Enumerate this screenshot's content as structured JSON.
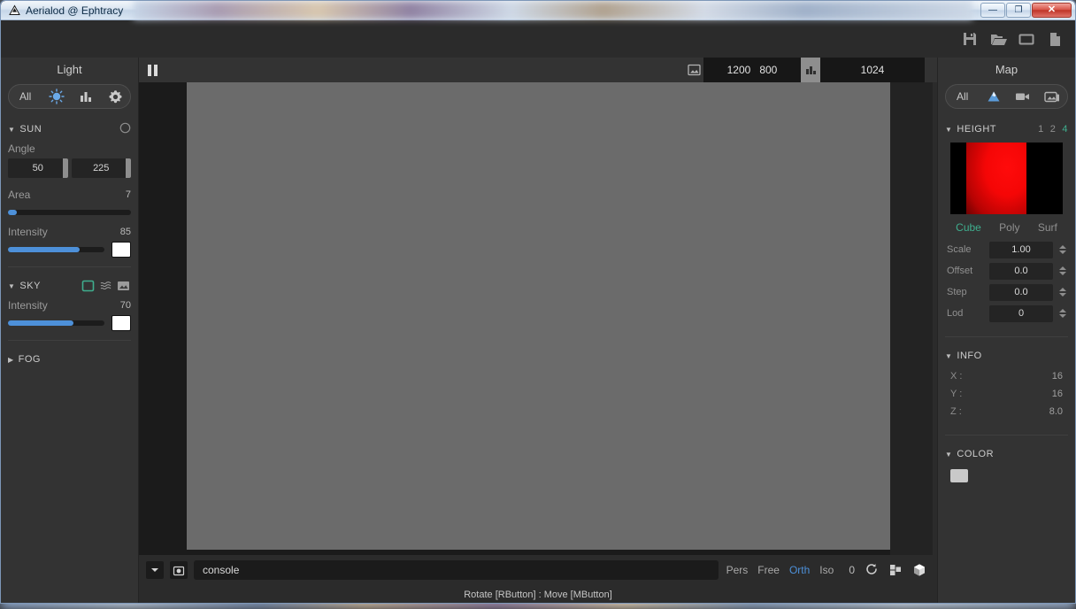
{
  "window": {
    "title": "Aerialod @ Ephtracy",
    "app_icon": "triangle-mountain-icon",
    "minimize_label": "—",
    "maximize_label": "❐",
    "close_label": "✕"
  },
  "toolbar": {
    "icons": [
      {
        "name": "save-icon",
        "label": "Save"
      },
      {
        "name": "open-folder-icon",
        "label": "Open"
      },
      {
        "name": "folder-icon",
        "label": "Folder"
      },
      {
        "name": "new-file-icon",
        "label": "New"
      }
    ]
  },
  "left_panel": {
    "title": "Light",
    "tabs": [
      {
        "name": "all",
        "label": "All",
        "active": false
      },
      {
        "name": "sun",
        "label": "sun-icon",
        "active": true
      },
      {
        "name": "histogram",
        "label": "bar-chart-icon",
        "active": false
      },
      {
        "name": "settings",
        "label": "gear-icon",
        "active": false
      }
    ],
    "sun": {
      "title": "SUN",
      "expanded": true,
      "toggle_icon": "circle-icon",
      "angle": {
        "label": "Angle",
        "value_a": "50",
        "value_b": "225"
      },
      "area": {
        "label": "Area",
        "value": "7",
        "fill_percent": 7
      },
      "intensity": {
        "label": "Intensity",
        "value": "85",
        "fill_percent": 74,
        "color": "#ffffff"
      }
    },
    "sky": {
      "title": "SKY",
      "expanded": true,
      "icons": [
        {
          "name": "solid-color-icon",
          "active": true
        },
        {
          "name": "gradient-icon",
          "active": false
        },
        {
          "name": "image-icon",
          "active": false
        }
      ],
      "intensity": {
        "label": "Intensity",
        "value": "70",
        "fill_percent": 68,
        "color": "#ffffff"
      }
    },
    "fog": {
      "title": "FOG",
      "expanded": false
    }
  },
  "viewport": {
    "pause_icon": "pause-icon",
    "image_icon": "image-icon",
    "resolution": {
      "width": "1200",
      "height": "800"
    },
    "samples_icon": "bar-chart-icon",
    "samples": "1024"
  },
  "bottom_bar": {
    "dropdown_icon": "chevron-down-icon",
    "camera_icon": "camera-icon",
    "console": {
      "value": "console",
      "placeholder": "console"
    },
    "projections": [
      {
        "label": "Pers",
        "active": false
      },
      {
        "label": "Free",
        "active": false
      },
      {
        "label": "Orth",
        "active": true
      },
      {
        "label": "Iso",
        "active": false
      }
    ],
    "angle_value": "0",
    "icons": [
      {
        "name": "rotate-icon"
      },
      {
        "name": "grid-layout-icon"
      },
      {
        "name": "cube-icon"
      }
    ],
    "status": "Rotate [RButton] : Move [MButton]"
  },
  "right_panel": {
    "title": "Map",
    "tabs": [
      {
        "name": "all",
        "label": "All",
        "active": false
      },
      {
        "name": "terrain",
        "label": "mountain-icon",
        "active": true
      },
      {
        "name": "camera",
        "label": "video-camera-icon",
        "active": false
      },
      {
        "name": "image",
        "label": "picture-icon",
        "active": false
      }
    ],
    "height": {
      "title": "HEIGHT",
      "expanded": true,
      "levels": [
        {
          "label": "1",
          "active": false
        },
        {
          "label": "2",
          "active": false
        },
        {
          "label": "4",
          "active": true
        }
      ],
      "preview_name": "heightmap-preview",
      "modes": [
        {
          "label": "Cube",
          "active": true
        },
        {
          "label": "Poly",
          "active": false
        },
        {
          "label": "Surf",
          "active": false
        }
      ],
      "fields": [
        {
          "label": "Scale",
          "value": "1.00"
        },
        {
          "label": "Offset",
          "value": "0.0"
        },
        {
          "label": "Step",
          "value": "0.0"
        },
        {
          "label": "Lod",
          "value": "0"
        }
      ]
    },
    "info": {
      "title": "INFO",
      "expanded": true,
      "rows": [
        {
          "label": "X :",
          "value": "16"
        },
        {
          "label": "Y :",
          "value": "16"
        },
        {
          "label": "Z :",
          "value": "8.0"
        }
      ]
    },
    "color": {
      "title": "COLOR",
      "expanded": true,
      "swatch": "#c9c9c9"
    }
  }
}
